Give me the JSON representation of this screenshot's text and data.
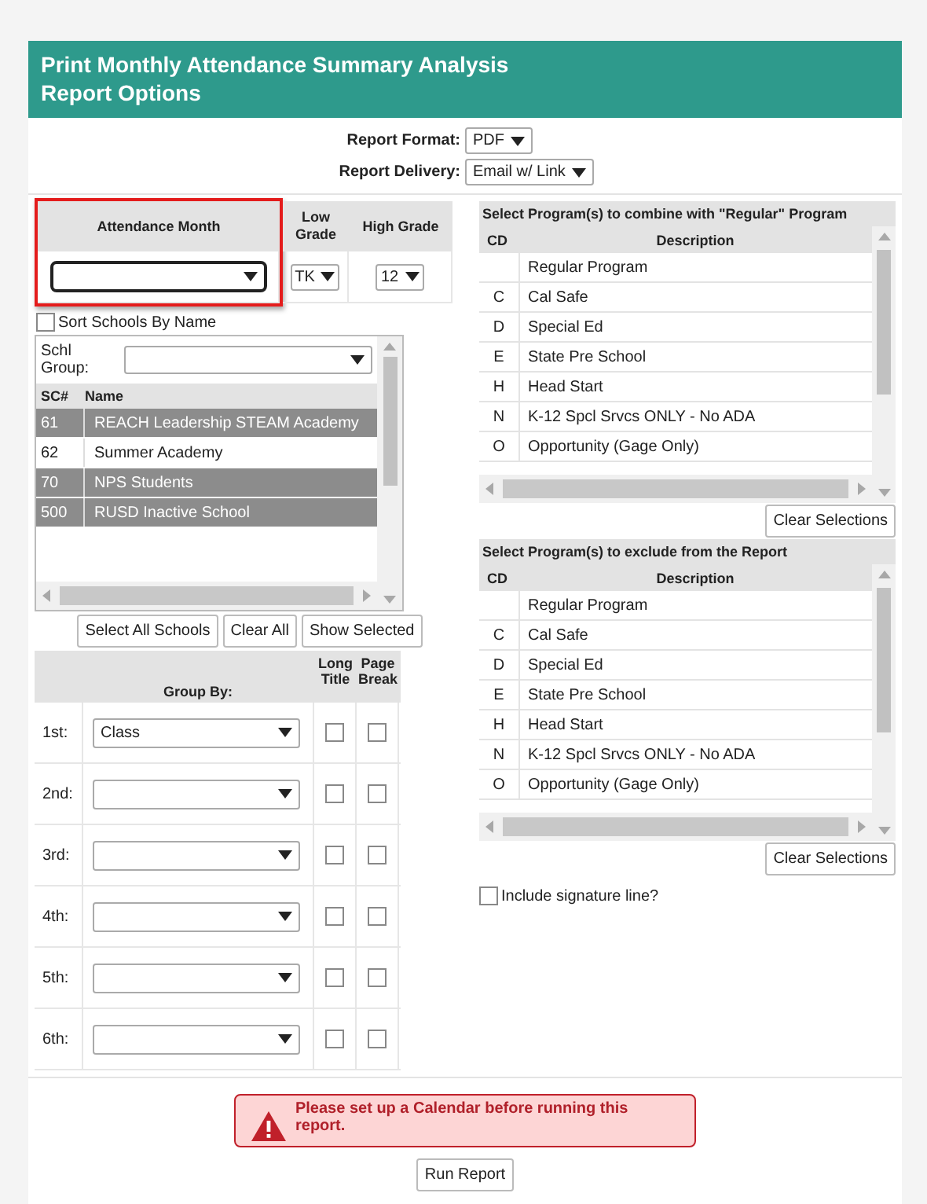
{
  "header": {
    "title": "Print Monthly Attendance Summary Analysis",
    "subtitle": "Report Options"
  },
  "report_format": {
    "label": "Report Format:",
    "value": "PDF"
  },
  "report_delivery": {
    "label": "Report Delivery:",
    "value": "Email w/ Link"
  },
  "attendance_month": {
    "label": "Attendance Month"
  },
  "low_grade": {
    "label": "Low Grade",
    "value": "TK"
  },
  "high_grade": {
    "label": "High Grade",
    "value": "12"
  },
  "sort_by_name": {
    "label": "Sort Schools By Name",
    "checked": false
  },
  "schools": {
    "group_label": "Schl Group:",
    "columns": [
      "SC#",
      "Name"
    ],
    "rows": [
      {
        "code": "61",
        "name": "REACH Leadership STEAM Academy",
        "selected": true
      },
      {
        "code": "62",
        "name": "Summer Academy",
        "selected": false
      },
      {
        "code": "70",
        "name": "NPS Students",
        "selected": true
      },
      {
        "code": "500",
        "name": "RUSD Inactive School",
        "selected": true
      }
    ]
  },
  "school_buttons": [
    "Select All Schools",
    "Clear All",
    "Show Selected"
  ],
  "group_by": {
    "columns": [
      "Group By:",
      "Long Title",
      "Page Break"
    ],
    "rows": [
      {
        "label": "1st:",
        "value": "Class",
        "long_title": false,
        "page_break": false
      },
      {
        "label": "2nd:",
        "long_title": false,
        "page_break": false
      },
      {
        "label": "3rd:",
        "long_title": false,
        "page_break": false
      },
      {
        "label": "4th:",
        "long_title": false,
        "page_break": false
      },
      {
        "label": "5th:",
        "long_title": false,
        "page_break": false
      },
      {
        "label": "6th:",
        "long_title": false,
        "page_break": false
      }
    ]
  },
  "program_lists": [
    {
      "title": "Select Program(s) to combine with \"Regular\" Program",
      "columns": [
        "CD",
        "Description"
      ],
      "clear_button": "Clear Selections",
      "rows": [
        {
          "description": "Regular Program"
        },
        {
          "code": "C",
          "description": "Cal Safe"
        },
        {
          "code": "D",
          "description": "Special Ed"
        },
        {
          "code": "E",
          "description": "State Pre School"
        },
        {
          "code": "H",
          "description": "Head Start"
        },
        {
          "code": "N",
          "description": "K-12 Spcl Srvcs ONLY - No ADA"
        },
        {
          "code": "O",
          "description": "Opportunity (Gage Only)"
        }
      ]
    },
    {
      "title": "Select Program(s) to exclude from the Report",
      "columns": [
        "CD",
        "Description"
      ],
      "clear_button": "Clear Selections",
      "rows": [
        {
          "description": "Regular Program"
        },
        {
          "code": "C",
          "description": "Cal Safe"
        },
        {
          "code": "D",
          "description": "Special Ed"
        },
        {
          "code": "E",
          "description": "State Pre School"
        },
        {
          "code": "H",
          "description": "Head Start"
        },
        {
          "code": "N",
          "description": "K-12 Spcl Srvcs ONLY - No ADA"
        },
        {
          "code": "O",
          "description": "Opportunity (Gage Only)"
        }
      ]
    }
  ],
  "signature_line": {
    "label": "Include signature line?",
    "checked": false
  },
  "alert": {
    "message": "Please set up a Calendar before running this report."
  },
  "run_button": "Run Report"
}
